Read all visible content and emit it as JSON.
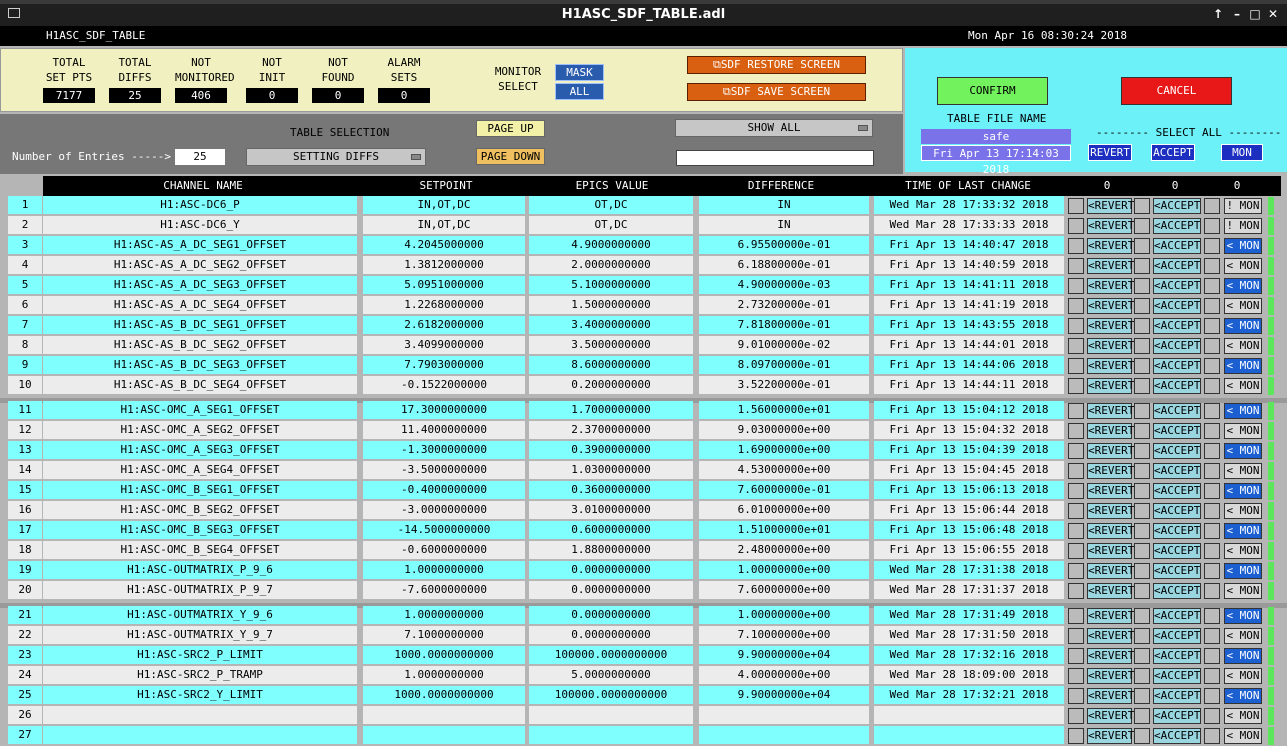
{
  "window": {
    "title": "H1ASC_SDF_TABLE.adl"
  },
  "header": {
    "name": "H1ASC_SDF_TABLE",
    "datetime": "Mon Apr 16 08:30:24 2018"
  },
  "stats": [
    {
      "label": "TOTAL\nSET PTS",
      "value": "7177"
    },
    {
      "label": "TOTAL\nDIFFS",
      "value": "25"
    },
    {
      "label": "NOT\nMONITORED",
      "value": "406"
    },
    {
      "label": "NOT\nINIT",
      "value": "0"
    },
    {
      "label": "NOT\nFOUND",
      "value": "0"
    },
    {
      "label": "ALARM\nSETS",
      "value": "0"
    }
  ],
  "monitor": {
    "label": "MONITOR\nSELECT",
    "mask": "MASK",
    "all": "ALL"
  },
  "sdf": {
    "restore": "SDF RESTORE SCREEN",
    "save": "SDF SAVE SCREEN"
  },
  "controls": {
    "entries_label": "Number of Entries ----->",
    "entries_value": "25",
    "table_selection_label": "TABLE SELECTION",
    "table_selection_value": "SETTING DIFFS",
    "page_up": "PAGE UP",
    "page_down": "PAGE DOWN",
    "show_all": "SHOW ALL",
    "text_input": ""
  },
  "right": {
    "confirm": "CONFIRM",
    "cancel": "CANCEL",
    "table_file_label": "TABLE FILE NAME",
    "table_file_value": "safe",
    "file_date": "Fri Apr 13 17:14:03 2018",
    "select_all_label": "-------- SELECT ALL --------",
    "revert_all": "REVERT",
    "accept_all": "ACCEPT",
    "mon_all": "MON"
  },
  "columns": {
    "channel": "CHANNEL NAME",
    "setpoint": "SETPOINT",
    "epics": "EPICS VALUE",
    "difference": "DIFFERENCE",
    "time": "TIME OF LAST CHANGE",
    "count_revert": "0",
    "count_accept": "0",
    "count_mon": "0"
  },
  "row_buttons": {
    "revert": "<REVERT",
    "accept": "<ACCEPT",
    "mon": "< MON",
    "mon_excl": "! MON"
  },
  "colors": {
    "cyan": "#80ffff",
    "light": "#ececec",
    "mon_blue": "#1b5fd0",
    "mon_gray": "#d8d8d8",
    "green": "#5ce65c"
  },
  "rows": [
    {
      "n": "1",
      "channel": "H1:ASC-DC6_P",
      "setpoint": "IN,OT,DC",
      "epics": "OT,DC",
      "diff": "IN",
      "time": "Wed Mar 28 17:33:32 2018",
      "mon": "excl"
    },
    {
      "n": "2",
      "channel": "H1:ASC-DC6_Y",
      "setpoint": "IN,OT,DC",
      "epics": "OT,DC",
      "diff": "IN",
      "time": "Wed Mar 28 17:33:33 2018",
      "mon": "excl"
    },
    {
      "n": "3",
      "channel": "H1:ASC-AS_A_DC_SEG1_OFFSET",
      "setpoint": "4.2045000000",
      "epics": "4.9000000000",
      "diff": "6.95500000e-01",
      "time": "Fri Apr 13 14:40:47 2018",
      "mon": "blue"
    },
    {
      "n": "4",
      "channel": "H1:ASC-AS_A_DC_SEG2_OFFSET",
      "setpoint": "1.3812000000",
      "epics": "2.0000000000",
      "diff": "6.18800000e-01",
      "time": "Fri Apr 13 14:40:59 2018",
      "mon": "gray"
    },
    {
      "n": "5",
      "channel": "H1:ASC-AS_A_DC_SEG3_OFFSET",
      "setpoint": "5.0951000000",
      "epics": "5.1000000000",
      "diff": "4.90000000e-03",
      "time": "Fri Apr 13 14:41:11 2018",
      "mon": "blue"
    },
    {
      "n": "6",
      "channel": "H1:ASC-AS_A_DC_SEG4_OFFSET",
      "setpoint": "1.2268000000",
      "epics": "1.5000000000",
      "diff": "2.73200000e-01",
      "time": "Fri Apr 13 14:41:19 2018",
      "mon": "gray"
    },
    {
      "n": "7",
      "channel": "H1:ASC-AS_B_DC_SEG1_OFFSET",
      "setpoint": "2.6182000000",
      "epics": "3.4000000000",
      "diff": "7.81800000e-01",
      "time": "Fri Apr 13 14:43:55 2018",
      "mon": "blue"
    },
    {
      "n": "8",
      "channel": "H1:ASC-AS_B_DC_SEG2_OFFSET",
      "setpoint": "3.4099000000",
      "epics": "3.5000000000",
      "diff": "9.01000000e-02",
      "time": "Fri Apr 13 14:44:01 2018",
      "mon": "gray"
    },
    {
      "n": "9",
      "channel": "H1:ASC-AS_B_DC_SEG3_OFFSET",
      "setpoint": "7.7903000000",
      "epics": "8.6000000000",
      "diff": "8.09700000e-01",
      "time": "Fri Apr 13 14:44:06 2018",
      "mon": "blue"
    },
    {
      "n": "10",
      "channel": "H1:ASC-AS_B_DC_SEG4_OFFSET",
      "setpoint": "-0.1522000000",
      "epics": "0.2000000000",
      "diff": "3.52200000e-01",
      "time": "Fri Apr 13 14:44:11 2018",
      "mon": "gray"
    },
    {
      "n": "11",
      "channel": "H1:ASC-OMC_A_SEG1_OFFSET",
      "setpoint": "17.3000000000",
      "epics": "1.7000000000",
      "diff": "1.56000000e+01",
      "time": "Fri Apr 13 15:04:12 2018",
      "mon": "blue"
    },
    {
      "n": "12",
      "channel": "H1:ASC-OMC_A_SEG2_OFFSET",
      "setpoint": "11.4000000000",
      "epics": "2.3700000000",
      "diff": "9.03000000e+00",
      "time": "Fri Apr 13 15:04:32 2018",
      "mon": "gray"
    },
    {
      "n": "13",
      "channel": "H1:ASC-OMC_A_SEG3_OFFSET",
      "setpoint": "-1.3000000000",
      "epics": "0.3900000000",
      "diff": "1.69000000e+00",
      "time": "Fri Apr 13 15:04:39 2018",
      "mon": "blue"
    },
    {
      "n": "14",
      "channel": "H1:ASC-OMC_A_SEG4_OFFSET",
      "setpoint": "-3.5000000000",
      "epics": "1.0300000000",
      "diff": "4.53000000e+00",
      "time": "Fri Apr 13 15:04:45 2018",
      "mon": "gray"
    },
    {
      "n": "15",
      "channel": "H1:ASC-OMC_B_SEG1_OFFSET",
      "setpoint": "-0.4000000000",
      "epics": "0.3600000000",
      "diff": "7.60000000e-01",
      "time": "Fri Apr 13 15:06:13 2018",
      "mon": "blue"
    },
    {
      "n": "16",
      "channel": "H1:ASC-OMC_B_SEG2_OFFSET",
      "setpoint": "-3.0000000000",
      "epics": "3.0100000000",
      "diff": "6.01000000e+00",
      "time": "Fri Apr 13 15:06:44 2018",
      "mon": "gray"
    },
    {
      "n": "17",
      "channel": "H1:ASC-OMC_B_SEG3_OFFSET",
      "setpoint": "-14.5000000000",
      "epics": "0.6000000000",
      "diff": "1.51000000e+01",
      "time": "Fri Apr 13 15:06:48 2018",
      "mon": "blue"
    },
    {
      "n": "18",
      "channel": "H1:ASC-OMC_B_SEG4_OFFSET",
      "setpoint": "-0.6000000000",
      "epics": "1.8800000000",
      "diff": "2.48000000e+00",
      "time": "Fri Apr 13 15:06:55 2018",
      "mon": "gray"
    },
    {
      "n": "19",
      "channel": "H1:ASC-OUTMATRIX_P_9_6",
      "setpoint": "1.0000000000",
      "epics": "0.0000000000",
      "diff": "1.00000000e+00",
      "time": "Wed Mar 28 17:31:38 2018",
      "mon": "blue"
    },
    {
      "n": "20",
      "channel": "H1:ASC-OUTMATRIX_P_9_7",
      "setpoint": "-7.6000000000",
      "epics": "0.0000000000",
      "diff": "7.60000000e+00",
      "time": "Wed Mar 28 17:31:37 2018",
      "mon": "gray"
    },
    {
      "n": "21",
      "channel": "H1:ASC-OUTMATRIX_Y_9_6",
      "setpoint": "1.0000000000",
      "epics": "0.0000000000",
      "diff": "1.00000000e+00",
      "time": "Wed Mar 28 17:31:49 2018",
      "mon": "blue"
    },
    {
      "n": "22",
      "channel": "H1:ASC-OUTMATRIX_Y_9_7",
      "setpoint": "7.1000000000",
      "epics": "0.0000000000",
      "diff": "7.10000000e+00",
      "time": "Wed Mar 28 17:31:50 2018",
      "mon": "gray"
    },
    {
      "n": "23",
      "channel": "H1:ASC-SRC2_P_LIMIT",
      "setpoint": "1000.0000000000",
      "epics": "100000.0000000000",
      "diff": "9.90000000e+04",
      "time": "Wed Mar 28 17:32:16 2018",
      "mon": "blue"
    },
    {
      "n": "24",
      "channel": "H1:ASC-SRC2_P_TRAMP",
      "setpoint": "1.0000000000",
      "epics": "5.0000000000",
      "diff": "4.00000000e+00",
      "time": "Wed Mar 28 18:09:00 2018",
      "mon": "gray"
    },
    {
      "n": "25",
      "channel": "H1:ASC-SRC2_Y_LIMIT",
      "setpoint": "1000.0000000000",
      "epics": "100000.0000000000",
      "diff": "9.90000000e+04",
      "time": "Wed Mar 28 17:32:21 2018",
      "mon": "blue"
    },
    {
      "n": "26",
      "channel": "",
      "setpoint": "",
      "epics": "",
      "diff": "",
      "time": "",
      "mon": "gray"
    },
    {
      "n": "27",
      "channel": "",
      "setpoint": "",
      "epics": "",
      "diff": "",
      "time": "",
      "mon": "gray"
    }
  ]
}
